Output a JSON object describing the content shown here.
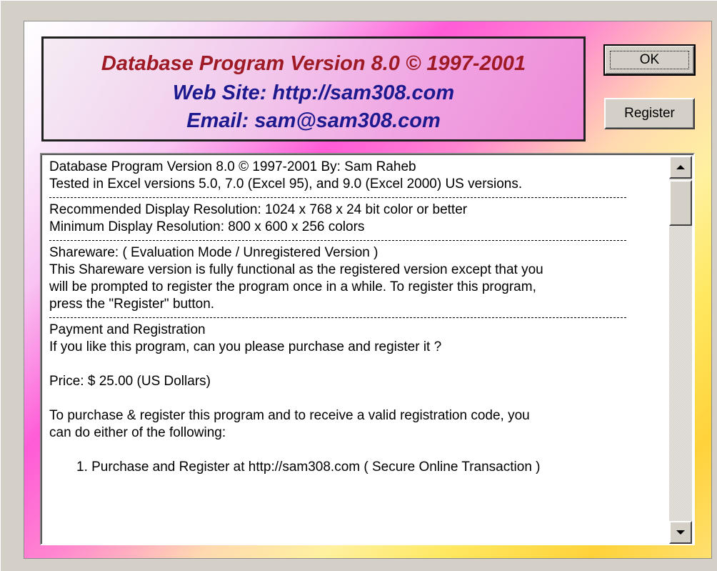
{
  "header": {
    "line1": "Database Program Version 8.0 © 1997-2001",
    "line2": "Web Site: http://sam308.com",
    "line3": "Email: sam@sam308.com"
  },
  "buttons": {
    "ok_label": "OK",
    "register_label": "Register"
  },
  "info_text": {
    "lines": [
      "Database Program Version 8.0    © 1997-2001 By: Sam Raheb",
      "Tested in Excel versions 5.0, 7.0 (Excel 95), and 9.0 (Excel 2000) US versions.",
      "Recommended Display Resolution:  1024 x 768 x 24 bit color or better",
      "Minimum Display Resolution:  800 x 600 x 256 colors",
      "Shareware: ( Evaluation Mode / Unregistered Version )",
      "This Shareware version is fully functional as the registered version except that you",
      "will be prompted to register the program once in a while. To register this program,",
      "press the \"Register\" button.",
      "Payment and Registration",
      "If you like this program, can you please purchase and register it ?",
      "Price: $ 25.00 (US Dollars)",
      "To purchase & register this program and to receive a valid registration code, you",
      "can do either of the following:",
      "1. Purchase and Register at http://sam308.com ( Secure Online Transaction )"
    ]
  },
  "icons": {
    "scroll_up": "scroll-up-arrow-icon",
    "scroll_down": "scroll-down-arrow-icon"
  }
}
